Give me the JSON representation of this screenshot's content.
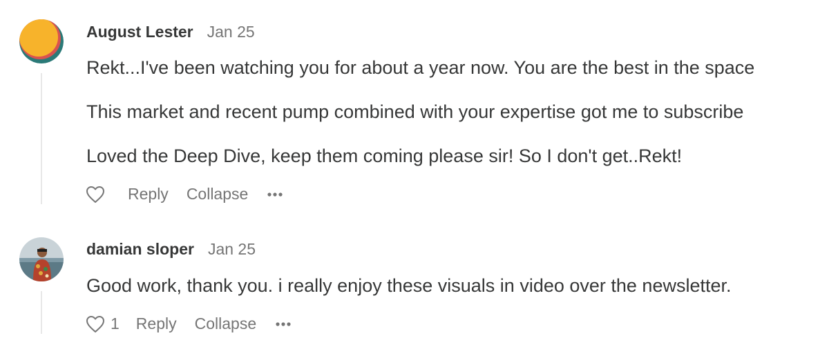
{
  "comments": [
    {
      "author": "August Lester",
      "date": "Jan 25",
      "avatar_icon": "avatar-orange-circle",
      "paragraphs": [
        "Rekt...I've been watching you for about a year now. You are the best in the space",
        "This market and recent pump combined with your expertise got me to subscribe",
        "Loved the Deep Dive, keep them coming please sir! So I don't get..Rekt!"
      ],
      "like_count": "",
      "actions": {
        "reply": "Reply",
        "collapse": "Collapse"
      }
    },
    {
      "author": "damian sloper",
      "date": "Jan 25",
      "avatar_icon": "avatar-photo",
      "paragraphs": [
        "Good work, thank you. i really enjoy these visuals in video over the newsletter."
      ],
      "like_count": "1",
      "actions": {
        "reply": "Reply",
        "collapse": "Collapse"
      }
    }
  ]
}
